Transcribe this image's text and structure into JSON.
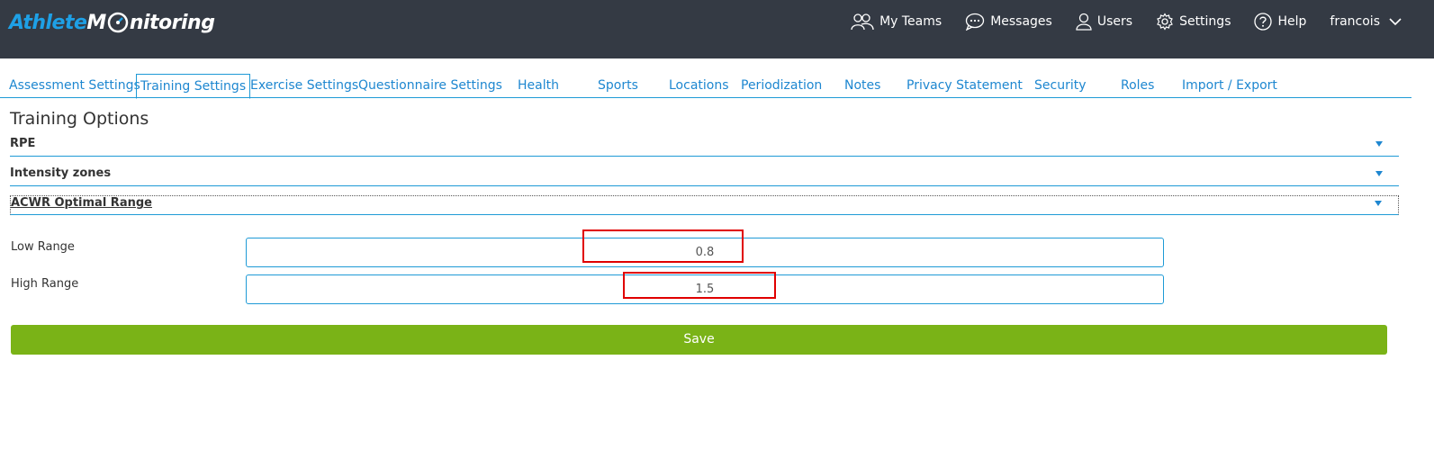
{
  "header": {
    "logo": {
      "part1": "Athlete",
      "part2_m": "M",
      "part2_rest": "nitoring"
    },
    "nav": {
      "my_teams": "My Teams",
      "messages": "Messages",
      "users": "Users",
      "settings": "Settings",
      "help": "Help",
      "user_name": "francois"
    }
  },
  "tabs": [
    "Assessment Settings",
    "Training Settings",
    "Exercise Settings",
    "Questionnaire Settings",
    "Health",
    "Sports",
    "Locations",
    "Periodization",
    "Notes",
    "Privacy Statement",
    "Security",
    "Roles",
    "Import / Export"
  ],
  "active_tab": "Training Settings",
  "main": {
    "title": "Training Options",
    "accordions": [
      "RPE",
      "Intensity zones",
      "ACWR Optimal Range"
    ],
    "fields": {
      "low_range": {
        "label": "Low Range",
        "value": "0.8"
      },
      "high_range": {
        "label": "High Range",
        "value": "1.5"
      }
    },
    "save_label": "Save"
  },
  "colors": {
    "header_bg": "#343a44",
    "link_blue": "#1e87d0",
    "border_blue": "#1e9ad6",
    "save_green": "#7ab317",
    "highlight_red": "#e00000"
  }
}
